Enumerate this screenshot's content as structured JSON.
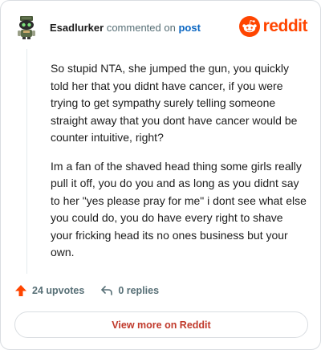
{
  "header": {
    "username": "Esadlurker",
    "action_text": "commented on",
    "post_link": "post",
    "avatar_icon": "snoo-avatar-icon",
    "brand_icon": "reddit-snoo-icon",
    "brand_name": "reddit"
  },
  "comment": {
    "paragraphs": [
      "So stupid NTA, she jumped the gun, you quickly told her that you didnt have cancer, if you were trying to get sympathy surely telling someone straight away that you dont have cancer would be counter intuitive, right?",
      "Im a fan of the shaved head thing some girls really pull it off, you do you and as long as you didnt say to her \"yes please pray for me\" i dont see what else you could do, you do have every right to shave your fricking head its no ones business but your own."
    ]
  },
  "actions": {
    "upvotes_label": "24 upvotes",
    "upvote_icon": "upvote-arrow-icon",
    "replies_label": "0 replies",
    "reply_icon": "reply-arrow-icon"
  },
  "footer": {
    "view_more_label": "View more on Reddit"
  },
  "colors": {
    "brand": "#ff4500",
    "link": "#0a66c2",
    "muted": "#576f76",
    "cta": "#c0392b",
    "border": "#d9dde1"
  }
}
